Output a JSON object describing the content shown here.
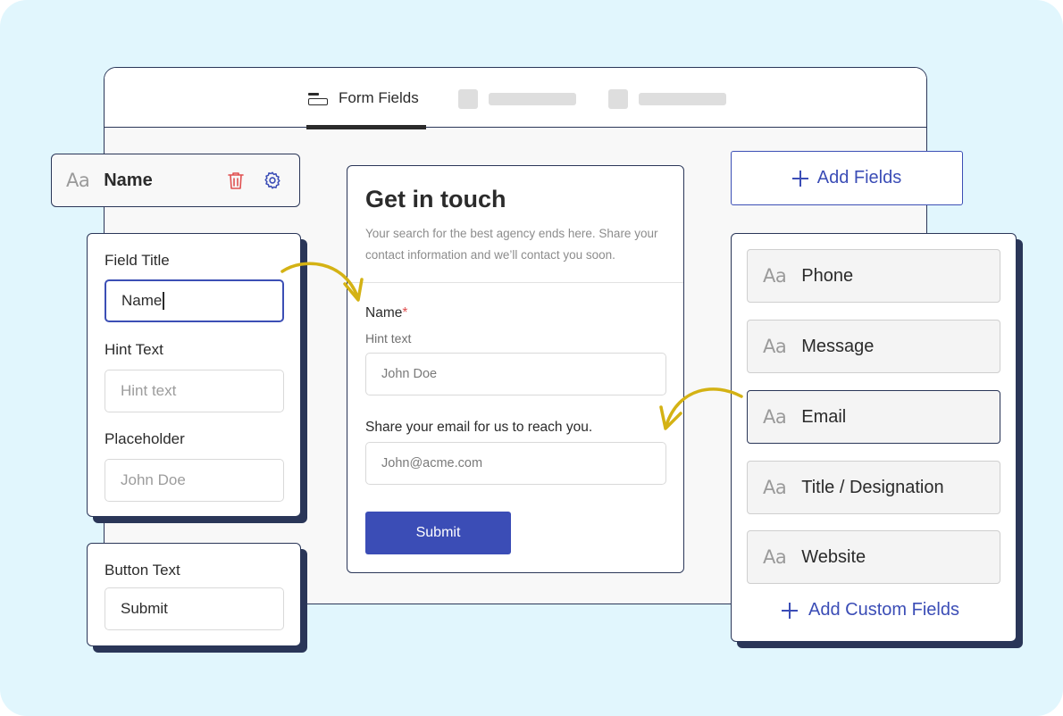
{
  "tabs": {
    "active_label": "Form Fields"
  },
  "selected_field": {
    "aa": "Aa",
    "label": "Name"
  },
  "settings": {
    "field_title_label": "Field Title",
    "field_title_value": "Name",
    "hint_text_label": "Hint Text",
    "hint_text_placeholder": "Hint text",
    "placeholder_label": "Placeholder",
    "placeholder_placeholder": "John Doe"
  },
  "button_settings": {
    "label": "Button Text",
    "value": "Submit"
  },
  "form": {
    "title": "Get in touch",
    "description": "Your search for the best agency ends here. Share your contact information and we’ll contact you soon.",
    "name_label": "Name",
    "required_mark": "*",
    "hint": "Hint text",
    "name_placeholder": "John Doe",
    "email_label": "Share your email for us to reach you.",
    "email_placeholder": "John@acme.com",
    "submit_label": "Submit"
  },
  "add_fields_label": "Add Fields",
  "field_list": {
    "aa": "Aa",
    "items": [
      {
        "label": "Phone"
      },
      {
        "label": "Message"
      },
      {
        "label": "Email"
      },
      {
        "label": "Title / Designation"
      },
      {
        "label": "Website"
      }
    ],
    "add_custom_label": "Add Custom Fields"
  },
  "colors": {
    "background": "#e1f6fd",
    "accent": "#3b4db6",
    "outline": "#2a3658",
    "arrow": "#d4b214",
    "delete": "#e05050"
  }
}
